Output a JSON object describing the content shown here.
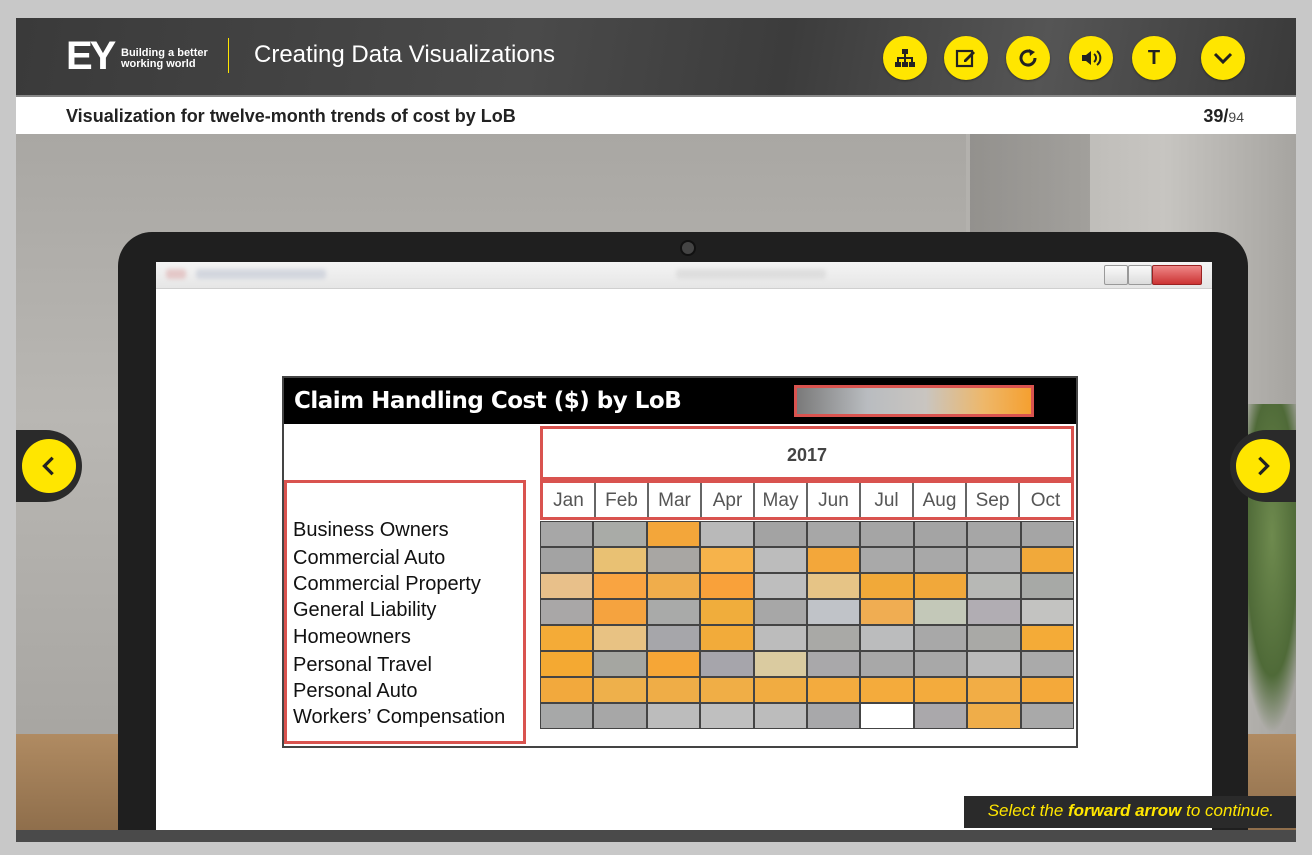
{
  "header": {
    "logo": "EY",
    "tagline_line1": "Building a better",
    "tagline_line2": "working world",
    "course_title": "Creating Data Visualizations",
    "buttons": [
      {
        "name": "sitemap-icon"
      },
      {
        "name": "notes-icon"
      },
      {
        "name": "replay-icon"
      },
      {
        "name": "audio-icon"
      },
      {
        "name": "transcript-icon",
        "label": "T"
      },
      {
        "name": "menu-chevron-icon"
      }
    ]
  },
  "subheader": {
    "slide_title": "Visualization for twelve-month trends of cost by LoB",
    "current_page": "39",
    "separator": "/",
    "total_pages": "94"
  },
  "chart": {
    "title": "Claim Handling Cost ($) by LoB",
    "year": "2017",
    "months": [
      "Jan",
      "Feb",
      "Mar",
      "Apr",
      "May",
      "Jun",
      "Jul",
      "Aug",
      "Sep",
      "Oct"
    ],
    "lob": [
      "Business  Owners",
      "Commercial Auto",
      "Commercial Property",
      "General Liability",
      "Homeowners",
      "Personal Travel",
      "Personal Auto",
      "Workers’ Compensation"
    ],
    "legend_gradient": {
      "low": "#7a7a7a",
      "mid": "#c9c5c0",
      "high": "#f5a030"
    }
  },
  "chart_data": {
    "type": "heatmap",
    "title": "Claim Handling Cost ($) by LoB",
    "x": [
      "Jan",
      "Feb",
      "Mar",
      "Apr",
      "May",
      "Jun",
      "Jul",
      "Aug",
      "Sep",
      "Oct"
    ],
    "y": [
      "Business  Owners",
      "Commercial Auto",
      "Commercial Property",
      "General Liability",
      "Homeowners",
      "Personal Travel",
      "Personal Auto",
      "Workers’ Compensation"
    ],
    "colors": [
      [
        "#a7a7a7",
        "#a9aba7",
        "#f3a63a",
        "#b9b9b9",
        "#a3a3a3",
        "#a7a7a7",
        "#a5a5a5",
        "#a4a4a4",
        "#a6a6a6",
        "#a5a5a5"
      ],
      [
        "#a3a3a3",
        "#e9c173",
        "#a8a6a3",
        "#f6b34b",
        "#bcbcbc",
        "#f3a73a",
        "#a9a9a9",
        "#a8a8a8",
        "#aeaeae",
        "#f1a93a"
      ],
      [
        "#e8c08a",
        "#f9a441",
        "#f0ad4b",
        "#f9a13a",
        "#bebebe",
        "#e6c486",
        "#f1a939",
        "#f1a83a",
        "#b7b8b5",
        "#a7a9a6"
      ],
      [
        "#a9a7a7",
        "#f5a33f",
        "#a9aaa9",
        "#f0ad3c",
        "#a7a7a7",
        "#c0c3c8",
        "#f0ad52",
        "#c3c8b8",
        "#b1adb3",
        "#c3c3c1"
      ],
      [
        "#f4ab37",
        "#e8c283",
        "#a6a6aa",
        "#f2ab3a",
        "#bcbcbc",
        "#a9a9a6",
        "#bbbcbd",
        "#a8a8a8",
        "#a9a9a6",
        "#f4ab37"
      ],
      [
        "#f4a932",
        "#a5a6a1",
        "#f6a636",
        "#a6a5ab",
        "#dacba0",
        "#a9a8aa",
        "#a8a8a8",
        "#a8a8a8",
        "#bababa",
        "#aaaaaa"
      ],
      [
        "#f2a93d",
        "#eeb04b",
        "#efad47",
        "#f0ae46",
        "#f1ac41",
        "#f3ab3e",
        "#f4ab3c",
        "#f3ab3d",
        "#f2ad45",
        "#f4a93a"
      ],
      [
        "#a7a8a8",
        "#a7a7a7",
        "#bcbcbc",
        "#bfbfbf",
        "#bcbcbc",
        "#a8a8aa",
        "#ffffff",
        "#aaa8ab",
        "#efad49",
        "#a9a9a9"
      ]
    ]
  },
  "navigation": {
    "prev_label": "Previous",
    "next_label": "Next"
  },
  "instruction": {
    "part1": "Select the ",
    "bold": "forward arrow",
    "part2": " to continue."
  },
  "app_window": {
    "title": "Presentation1 - PowerPoint"
  }
}
